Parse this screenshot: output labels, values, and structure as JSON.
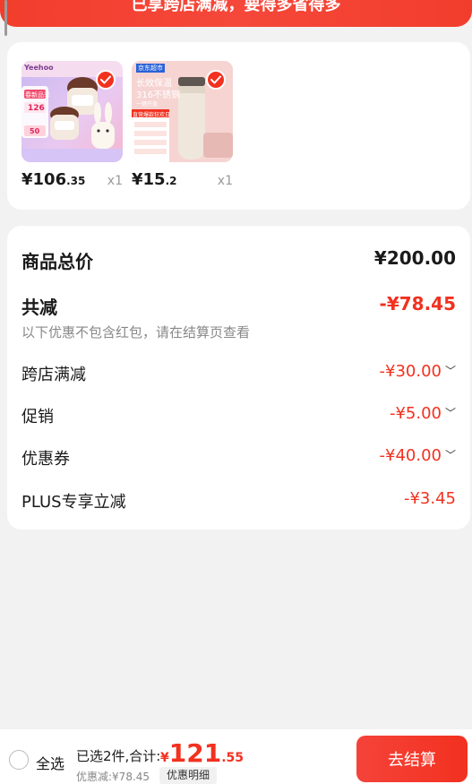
{
  "banner": {
    "text": "已享跨店满减，要得多省得多"
  },
  "products": [
    {
      "price_int": "¥106",
      "price_dec": ".35",
      "qty": "x1"
    },
    {
      "price_int": "¥15",
      "price_dec": ".2",
      "qty": "x1"
    }
  ],
  "product_images": {
    "p1": {
      "badge_tl": "Yeehoo",
      "promo_line1": "春新品季",
      "promo_value": "126",
      "promo_small": "50"
    },
    "p2": {
      "brand_badge": "京东超市",
      "headline1": "长效保温",
      "headline2": "316不锈钢",
      "sub": "一键开盖",
      "promo_tag": "直营爆款狂欢日"
    }
  },
  "summary": {
    "total_label": "商品总价",
    "total_value": "¥200.00",
    "discount_label": "共减",
    "discount_value": "-¥78.45",
    "discount_note": "以下优惠不包含红包，请在结算页查看",
    "items": [
      {
        "label": "跨店满减",
        "value": "-¥30.00",
        "expandable": true
      },
      {
        "label": "促销",
        "value": "-¥5.00",
        "expandable": true
      },
      {
        "label": "优惠券",
        "value": "-¥40.00",
        "expandable": true
      },
      {
        "label": "PLUS专享立减",
        "value": "-¥3.45",
        "expandable": false
      }
    ]
  },
  "bottom_bar": {
    "select_all": "全选",
    "selected_text": "已选2件,合计:",
    "currency": "¥",
    "total_int": "121",
    "total_dec": ".55",
    "discount_line": "优惠减:¥78.45",
    "detail_button": "优惠明细",
    "checkout_button": "去结算"
  },
  "colors": {
    "accent": "#f2311f",
    "background": "#f2f2f2",
    "card": "#ffffff"
  }
}
